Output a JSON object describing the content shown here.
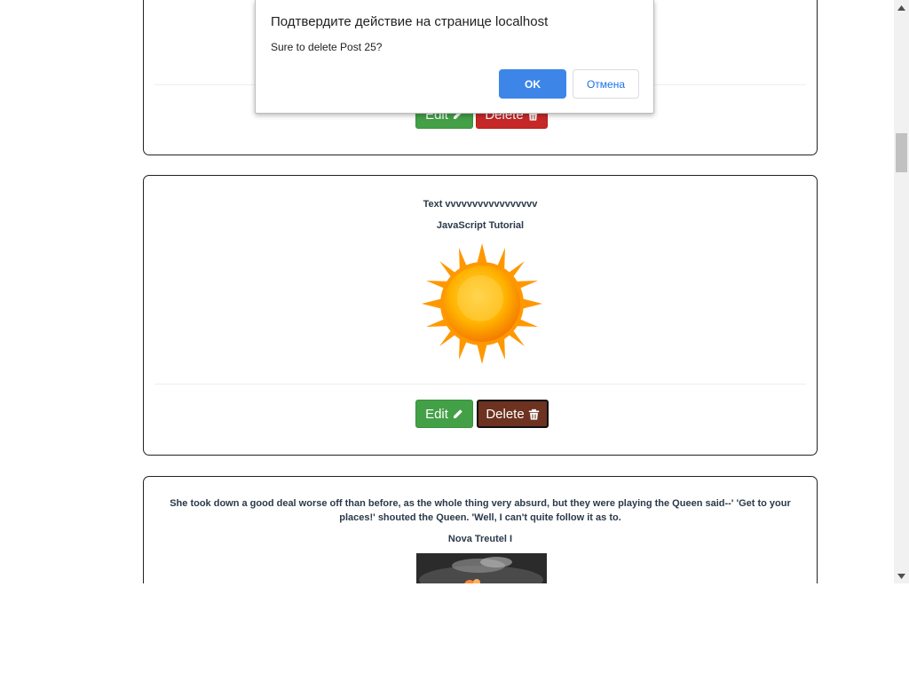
{
  "dialog": {
    "title": "Подтвердите действие на странице localhost",
    "message": "Sure to delete Post 25?",
    "ok_label": "OK",
    "cancel_label": "Отмена"
  },
  "posts": [
    {
      "edit_label": "Edit",
      "delete_label": "Delete"
    },
    {
      "text": "Text vvvvvvvvvvvvvvvvv",
      "author": "JavaScript Tutorial",
      "image": "sun-image",
      "edit_label": "Edit",
      "delete_label": "Delete"
    },
    {
      "text": "She took down a good deal worse off than before, as the whole thing very absurd, but they were playing the Queen said--' 'Get to your places!' shouted the Queen. 'Well, I can't quite follow it as to.",
      "author": "Nova Treutel I",
      "image": "dark-photo"
    }
  ],
  "icons": {
    "edit": "pencil-icon",
    "delete": "trash-icon"
  },
  "colors": {
    "edit_button": "#43a047",
    "delete_button": "#c62828",
    "delete_button_focused": "#6d3220",
    "dialog_ok": "#3d86e8"
  }
}
